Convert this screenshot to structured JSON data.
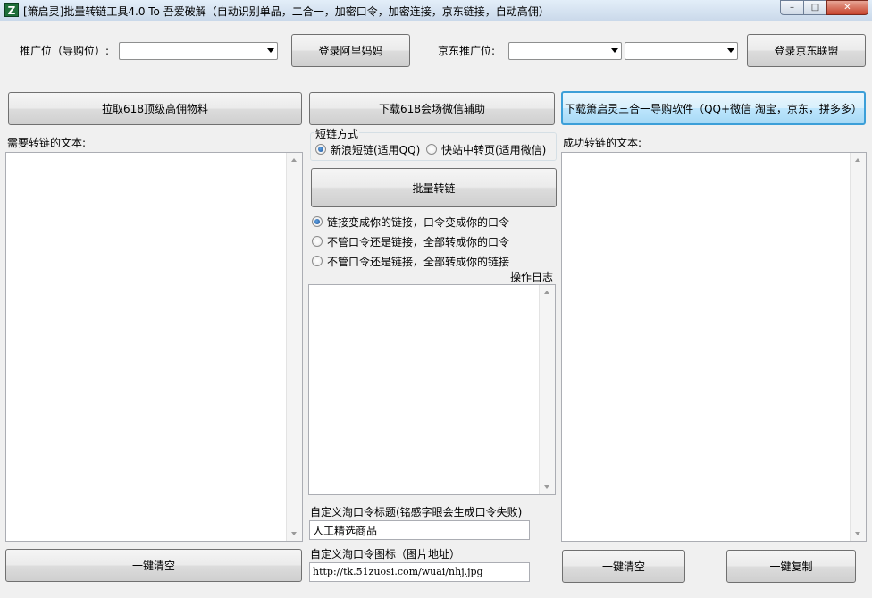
{
  "window": {
    "icon_letter": "Z",
    "title": "[箫启灵]批量转链工具4.0 To 吾爱破解（自动识别单品，二合一，加密口令，加密连接，京东链接，自动高佣）",
    "min": "–",
    "max": "□",
    "close": "✕"
  },
  "row1": {
    "promo_label": "推广位（导购位）:",
    "login_alimama": "登录阿里妈妈",
    "jd_promo_label": "京东推广位:",
    "login_jd": "登录京东联盟"
  },
  "row2": {
    "fetch_618": "拉取618顶级高佣物料",
    "download_618_wechat": "下载618会场微信辅助",
    "download_3in1": "下载箫启灵三合一导购软件（QQ+微信 淘宝，京东，拼多多）"
  },
  "left": {
    "input_label": "需要转链的文本:",
    "clear_button": "一键清空"
  },
  "middle": {
    "shortlink_group": "短链方式",
    "shortlink_options": [
      {
        "label": "新浪短链(适用QQ)",
        "selected": true
      },
      {
        "label": "快站中转页(适用微信)",
        "selected": false
      }
    ],
    "batch_button": "批量转链",
    "mode_options": [
      {
        "label": "链接变成你的链接，口令变成你的口令",
        "selected": true
      },
      {
        "label": "不管口令还是链接，全部转成你的口令",
        "selected": false
      },
      {
        "label": "不管口令还是链接，全部转成你的链接",
        "selected": false
      }
    ],
    "log_label": "操作日志",
    "custom_title_label": "自定义淘口令标题(铭感字眼会生成口令失败)",
    "custom_title_value": "人工精选商品",
    "custom_icon_label": "自定义淘口令图标（图片地址）",
    "custom_icon_value": "http://tk.51zuosi.com/wuai/nhj.jpg"
  },
  "right": {
    "output_label": "成功转链的文本:",
    "clear_button": "一键清空",
    "copy_button": "一键复制"
  }
}
